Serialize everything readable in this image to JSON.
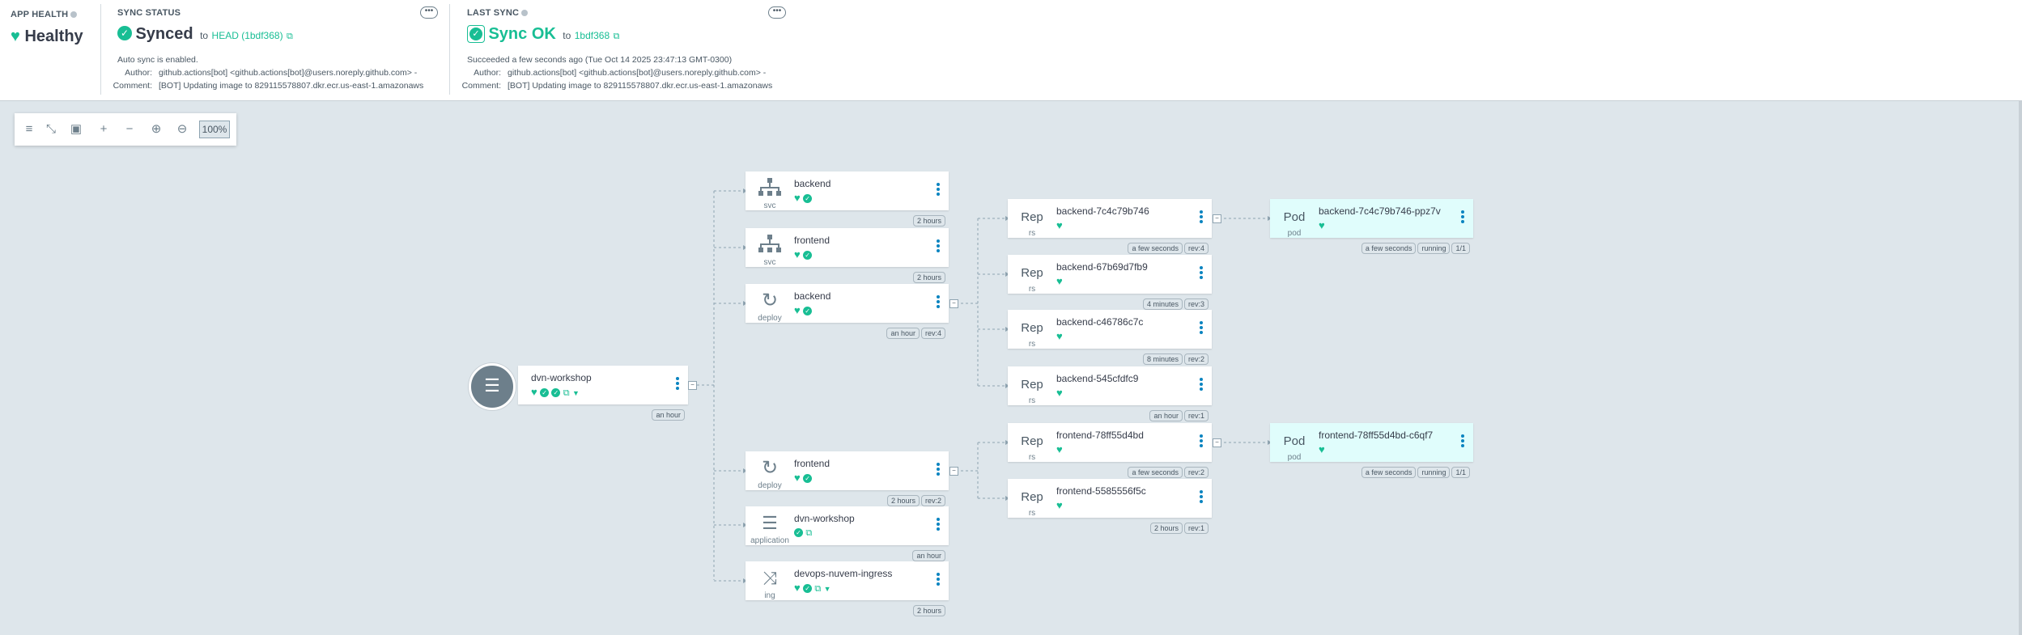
{
  "header": {
    "app_health": {
      "title": "APP HEALTH",
      "status": "Healthy"
    },
    "sync_status": {
      "title": "SYNC STATUS",
      "status": "Synced",
      "to": "to",
      "revision": "HEAD (1bdf368)",
      "auto_sync": "Auto sync is enabled.",
      "author_label": "Author:",
      "author": "github.actions[bot] <github.actions[bot]@users.noreply.github.com> -",
      "comment_label": "Comment:",
      "comment": "[BOT] Updating image to 829115578807.dkr.ecr.us-east-1.amazonaws"
    },
    "last_sync": {
      "title": "LAST SYNC",
      "status": "Sync OK",
      "to": "to",
      "revision": "1bdf368",
      "succeeded": "Succeeded a few seconds ago (Tue Oct 14 2025 23:47:13 GMT-0300)",
      "author_label": "Author:",
      "author": "github.actions[bot] <github.actions[bot]@users.noreply.github.com> -",
      "comment_label": "Comment:",
      "comment": "[BOT] Updating image to 829115578807.dkr.ecr.us-east-1.amazonaws"
    },
    "more_label": "•••"
  },
  "toolbar": {
    "zoom": "100%"
  },
  "nodes": {
    "root": {
      "name": "dvn-workshop",
      "age": "an hour"
    },
    "svc_backend": {
      "name": "backend",
      "kind": "svc",
      "age": "2 hours"
    },
    "svc_frontend": {
      "name": "frontend",
      "kind": "svc",
      "age": "2 hours"
    },
    "deploy_backend": {
      "name": "backend",
      "kind": "deploy",
      "age": "an hour",
      "rev": "rev:4"
    },
    "deploy_frontend": {
      "name": "frontend",
      "kind": "deploy",
      "age": "2 hours",
      "rev": "rev:2"
    },
    "application": {
      "name": "dvn-workshop",
      "kind": "application",
      "age": "an hour"
    },
    "ingress": {
      "name": "devops-nuvem-ingress",
      "kind": "ing",
      "age": "2 hours"
    },
    "rs1": {
      "name": "backend-7c4c79b746",
      "kind": "rs",
      "kind_text": "Rep",
      "age": "a few seconds",
      "rev": "rev:4"
    },
    "rs2": {
      "name": "backend-67b69d7fb9",
      "kind": "rs",
      "kind_text": "Rep",
      "age": "4 minutes",
      "rev": "rev:3"
    },
    "rs3": {
      "name": "backend-c46786c7c",
      "kind": "rs",
      "kind_text": "Rep",
      "age": "8 minutes",
      "rev": "rev:2"
    },
    "rs4": {
      "name": "backend-545cfdfc9",
      "kind": "rs",
      "kind_text": "Rep",
      "age": "an hour",
      "rev": "rev:1"
    },
    "rs5": {
      "name": "frontend-78ff55d4bd",
      "kind": "rs",
      "kind_text": "Rep",
      "age": "a few seconds",
      "rev": "rev:2"
    },
    "rs6": {
      "name": "frontend-5585556f5c",
      "kind": "rs",
      "kind_text": "Rep",
      "age": "2 hours",
      "rev": "rev:1"
    },
    "pod1": {
      "name": "backend-7c4c79b746-ppz7v",
      "kind": "pod",
      "kind_text": "Pod",
      "age": "a few seconds",
      "state": "running",
      "ready": "1/1"
    },
    "pod2": {
      "name": "frontend-78ff55d4bd-c6qf7",
      "kind": "pod",
      "kind_text": "Pod",
      "age": "a few seconds",
      "state": "running",
      "ready": "1/1"
    }
  },
  "colors": {
    "healthy": "#18be94",
    "kebab": "#0dadea"
  },
  "icons": {
    "heart": "heart-icon",
    "check": "check-circle-icon",
    "external": "external-link-icon"
  }
}
